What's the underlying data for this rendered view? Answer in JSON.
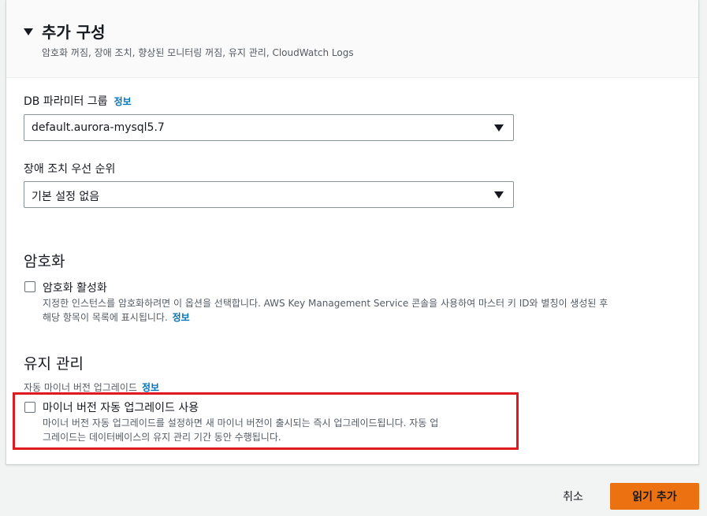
{
  "additional_config": {
    "title": "추가 구성",
    "description": "암호화 꺼짐, 장애 조치, 향상된 모니터링 꺼짐, 유지 관리, CloudWatch Logs"
  },
  "db_parameter_group": {
    "label": "DB 파라미터 그룹",
    "info": "정보",
    "value": "default.aurora-mysql5.7"
  },
  "failover_priority": {
    "label": "장애 조치 우선 순위",
    "value": "기본 설정 없음"
  },
  "encryption": {
    "title": "암호화",
    "checkbox_label": "암호화 활성화",
    "checked": false,
    "description": "지정한 인스턴스를 암호화하려면 이 옵션을 선택합니다. AWS Key Management Service 콘솔을 사용하여 마스터 키 ID와 별칭이 생성된 후",
    "description_line2": "해당 항목이 목록에 표시됩니다.",
    "info": "정보"
  },
  "maintenance": {
    "title": "유지 관리",
    "sub_label": "자동 마이너 버전 업그레이드",
    "info": "정보",
    "checkbox_label": "마이너 버전 자동 업그레이드 사용",
    "checked": false,
    "description_line1": "마이너 버전 자동 업그레이드를 설정하면 새 마이너 버전이 출시되는 즉시 업그레이드됩니다. 자동 업",
    "description_line2": "그레이드는 데이터베이스의 유지 관리 기간 동안 수행됩니다."
  },
  "footer": {
    "cancel_label": "취소",
    "submit_label": "읽기 추가"
  },
  "colors": {
    "link": "#0073bb",
    "primary": "#ec7211",
    "highlight": "#e0181f"
  },
  "icons": {
    "section_toggle": "caret-down-icon",
    "select_dropdown": "caret-down-icon"
  }
}
